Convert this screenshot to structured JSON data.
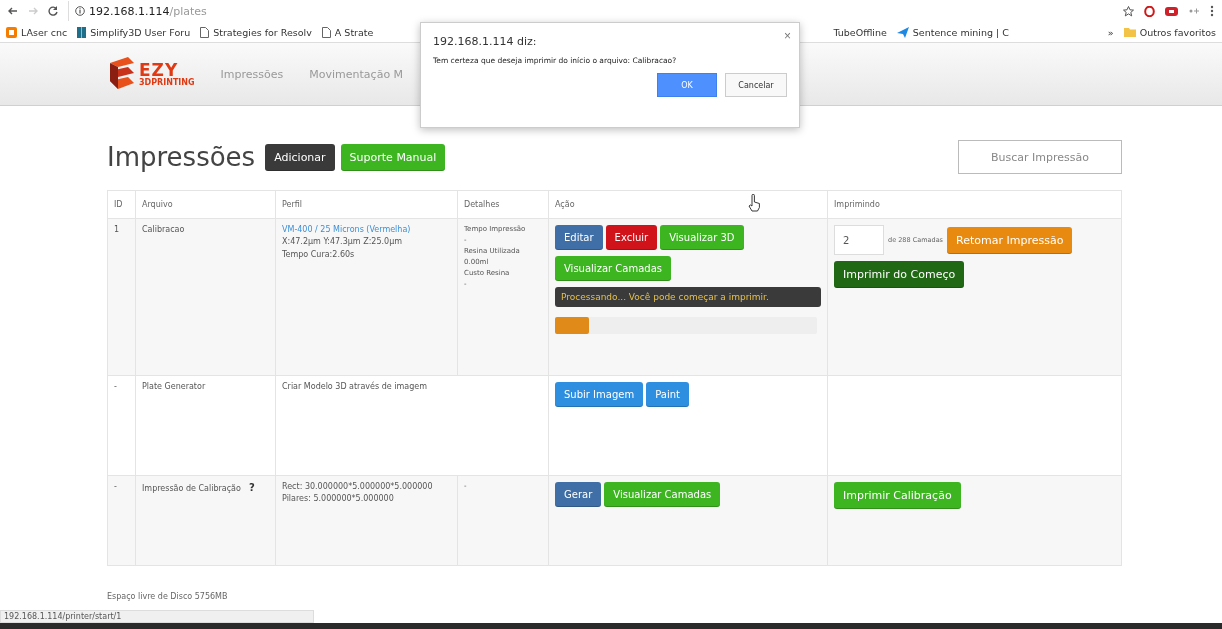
{
  "browser": {
    "url_host": "192.168.1.114",
    "url_path": "/plates",
    "bookmarks": [
      {
        "label": "LAser cnc",
        "kind": "blog"
      },
      {
        "label": "Simplify3D User Foru",
        "kind": "book"
      },
      {
        "label": "Strategies for Resolv",
        "kind": "page"
      },
      {
        "label": "A Strate",
        "kind": "page"
      }
    ],
    "bookmarks_right": [
      {
        "label": "TubeOffline",
        "kind": "none"
      },
      {
        "label": "Sentence mining | C",
        "kind": "plane"
      }
    ],
    "overflow": "»",
    "other_bookmarks": "Outros favoritos"
  },
  "navbar": {
    "logo": "EZY",
    "logo_sub": "3DPRINTING",
    "items": [
      "Impressões",
      "Movimentação M"
    ]
  },
  "dialog": {
    "title": "192.168.1.114 diz:",
    "message": "Tem certeza que deseja imprimir do início o arquivo: Calibracao?",
    "close": "×",
    "ok": "OK",
    "cancel": "Cancelar"
  },
  "page": {
    "title": "Impressões",
    "buttons": [
      {
        "label": "Adicionar",
        "kind": "dark"
      },
      {
        "label": "Suporte Manual",
        "kind": "success"
      }
    ],
    "search": {
      "placeholder": "Buscar Impressão"
    }
  },
  "table": {
    "columns": [
      "ID",
      "Arquivo",
      "Perfil",
      "Detalhes",
      "Ação",
      "Imprimindo"
    ],
    "rows": [
      {
        "id": "1",
        "file": "Calibracao",
        "profile_link": "VM-400 / 25 Microns (Vermelha)",
        "profile_lines": [
          "X:47.2µm Y:47.3µm Z:25.0µm",
          "Tempo Cura:2.60s"
        ],
        "details": [
          "Tempo Impressão",
          "-",
          "Resina Utilizada",
          "0.00ml",
          "Custo Resina",
          "-"
        ],
        "actions": [
          {
            "label": "Editar",
            "kind": "primary"
          },
          {
            "label": "Excluir",
            "kind": "danger"
          },
          {
            "label": "Visualizar 3D",
            "kind": "success"
          },
          {
            "label": "Visualizar Camadas",
            "kind": "success"
          }
        ],
        "notice": "Processando... Você pode começar a imprimir.",
        "progress": {
          "level": 0.13
        },
        "printing": {
          "layer": "2",
          "layers_text": "de 288 Camadas",
          "buttons": [
            {
              "label": "Retomar Impressão",
              "kind": "warning"
            },
            {
              "label": "Imprimir do Começo",
              "kind": "darkgreen"
            }
          ]
        }
      },
      {
        "id": "-",
        "file": "Plate Generator",
        "profile_lines": [
          "Criar Modelo 3D através de imagem"
        ],
        "actions": [
          {
            "label": "Subir Imagem",
            "kind": "info"
          },
          {
            "label": "Paint",
            "kind": "info"
          }
        ],
        "printing": {}
      },
      {
        "id": "-",
        "file": "Impressão de Calibração",
        "help": "?",
        "profile_lines": [
          "Rect: 30.000000*5.000000*5.000000",
          "Pilares: 5.000000*5.000000"
        ],
        "details": [
          "-"
        ],
        "actions": [
          {
            "label": "Gerar",
            "kind": "primary"
          },
          {
            "label": "Visualizar Camadas",
            "kind": "success"
          }
        ],
        "printing": {
          "buttons": [
            {
              "label": "Imprimir Calibração",
              "kind": "success"
            }
          ]
        }
      }
    ]
  },
  "footer": {
    "disk": "Espaço livre de Disco 5756MB"
  },
  "status_bar": {
    "url": "192.168.1.114/printer/start/1"
  }
}
